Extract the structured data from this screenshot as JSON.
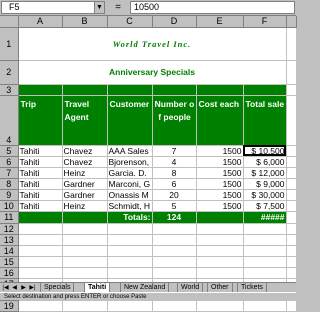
{
  "formula_bar": {
    "cell_ref": "F5",
    "equals": "=",
    "value": "10500",
    "dropdown": "▼"
  },
  "columns": [
    "A",
    "B",
    "C",
    "D",
    "E",
    "F"
  ],
  "rows": [
    "1",
    "2",
    "3",
    "4",
    "5",
    "6",
    "7",
    "8",
    "9",
    "10",
    "11",
    "12",
    "13",
    "14",
    "15",
    "16",
    "17",
    "18",
    "19"
  ],
  "title": "World Travel Inc.",
  "subtitle": "Anniversary Specials",
  "headers": {
    "trip": "Trip",
    "agent": "Travel Agent",
    "customer": "Customer",
    "people": "Number of people",
    "cost": "Cost each",
    "total": "Total sale"
  },
  "data": [
    {
      "trip": "Tahiti",
      "agent": "Chavez",
      "customer": "AAA Sales",
      "people": "7",
      "cost": "1500",
      "total": "$ 10,500"
    },
    {
      "trip": "Tahiti",
      "agent": "Chavez",
      "customer": "Bjorenson,",
      "people": "4",
      "cost": "1500",
      "total": "$ 6,000"
    },
    {
      "trip": "Tahiti",
      "agent": "Heinz",
      "customer": "Garcia. D.",
      "people": "8",
      "cost": "1500",
      "total": "$ 12,000"
    },
    {
      "trip": "Tahiti",
      "agent": "Gardner",
      "customer": "Marconi, G",
      "people": "6",
      "cost": "1500",
      "total": "$ 9,000"
    },
    {
      "trip": "Tahiti",
      "agent": "Gardner",
      "customer": "Onassis M",
      "people": "20",
      "cost": "1500",
      "total": "$ 30,000"
    },
    {
      "trip": "Tahiti",
      "agent": "Heinz",
      "customer": "Schmidt, H",
      "people": "5",
      "cost": "1500",
      "total": "$ 7,500"
    }
  ],
  "totals": {
    "label": "Totals:",
    "people": "124",
    "sale": "#####"
  },
  "tabs": {
    "nav": [
      "|◀",
      "◀",
      "▶",
      "▶|"
    ],
    "items": [
      "Specials",
      "Tahiti",
      "New Zealand",
      "World",
      "Other",
      "Tickets"
    ],
    "active": "Tahiti"
  },
  "status": "Select destination and press ENTER or choose Paste",
  "colors": {
    "accent_green": "#008000",
    "header_gray": "#c0c0c0"
  }
}
